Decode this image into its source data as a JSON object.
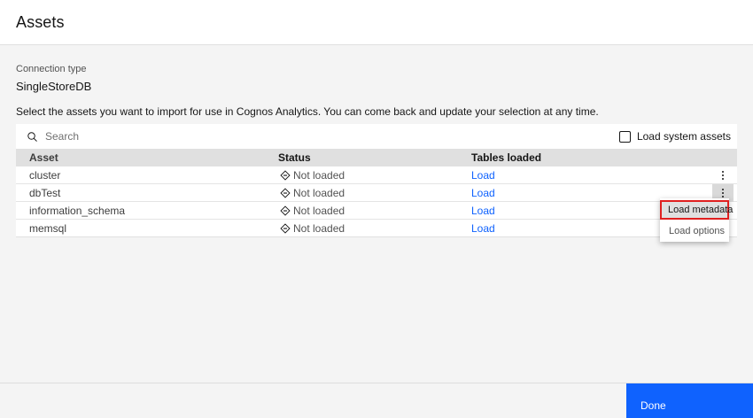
{
  "header": {
    "title": "Assets"
  },
  "connection": {
    "label": "Connection type",
    "value": "SingleStoreDB"
  },
  "description": "Select the assets you want to import for use in Cognos Analytics. You can come back and update your selection at any time.",
  "toolbar": {
    "search_placeholder": "Search",
    "search_value": "",
    "checkbox_label": "Load system assets",
    "checkbox_checked": false
  },
  "table": {
    "columns": {
      "asset": "Asset",
      "status": "Status",
      "tables": "Tables loaded"
    },
    "rows": [
      {
        "asset": "cluster",
        "status": "Not loaded",
        "tables": "Load"
      },
      {
        "asset": "dbTest",
        "status": "Not loaded",
        "tables": "Load"
      },
      {
        "asset": "information_schema",
        "status": "Not loaded",
        "tables": "Load"
      },
      {
        "asset": "memsql",
        "status": "Not loaded",
        "tables": "Load"
      }
    ],
    "active_row_index": 1
  },
  "context_menu": {
    "items": [
      {
        "label": "Load metadata",
        "highlighted": true
      },
      {
        "label": "Load options",
        "highlighted": false
      }
    ]
  },
  "footer": {
    "done_label": "Done"
  },
  "icons": {
    "search": "search-icon",
    "status": "status-undefined-diamond-icon",
    "overflow": "overflow-menu-vertical-icon"
  },
  "colors": {
    "accent_blue": "#0f62fe",
    "highlight_red": "#e02020",
    "page_background": "#f4f4f4",
    "table_header_background": "#e0e0e0",
    "surface_white": "#ffffff"
  }
}
